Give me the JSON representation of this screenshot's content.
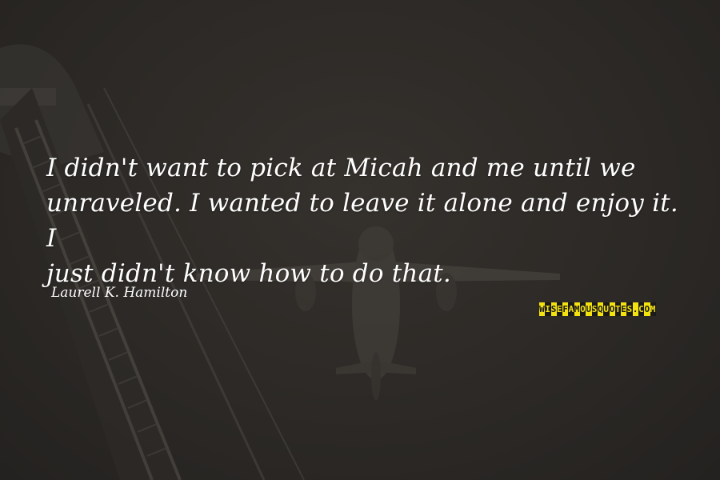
{
  "quote": {
    "lines": [
      "I didn't want to pick at Micah and me until we",
      "unraveled. I wanted to leave it alone and enjoy it. I",
      "just didn't know how to do that."
    ]
  },
  "author": "Laurell K. Hamilton",
  "watermark": "WISEFAMOUSQUOTES.COM",
  "colors": {
    "background": "#2d2a27",
    "text": "#ffffff",
    "watermark_yellow": "#f4e20f",
    "watermark_black": "#1a1a1a"
  },
  "icons": [
    "airplane-silhouette",
    "crane-structure"
  ]
}
